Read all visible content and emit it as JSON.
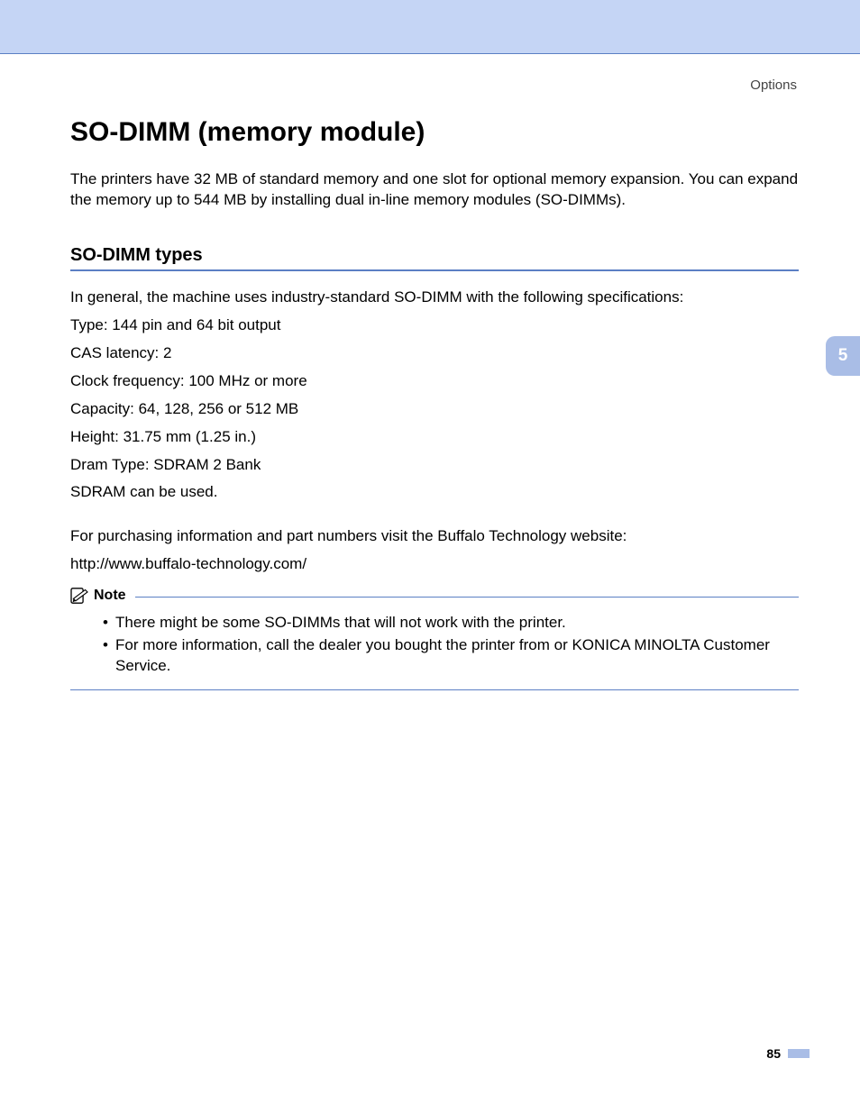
{
  "header": {
    "section_label": "Options"
  },
  "title": "SO-DIMM (memory module)",
  "intro": "The printers have 32 MB of standard memory and one slot for optional memory expansion. You can expand the memory up to 544 MB by installing dual in-line memory modules (SO-DIMMs).",
  "subheading": "SO-DIMM types",
  "specs": {
    "lead": "In general, the machine uses industry-standard SO-DIMM with the following specifications:",
    "lines": [
      "Type: 144 pin and 64 bit output",
      "CAS latency: 2",
      "Clock frequency: 100 MHz or more",
      "Capacity: 64, 128, 256 or 512 MB",
      "Height: 31.75 mm (1.25 in.)",
      "Dram Type: SDRAM 2 Bank",
      "SDRAM can be used."
    ],
    "purchase_line": "For purchasing information and part numbers visit the Buffalo Technology website:",
    "url": "http://www.buffalo-technology.com/"
  },
  "note": {
    "title": "Note",
    "items": [
      "There might be some SO-DIMMs that will not work with the printer.",
      "For more information, call the dealer you bought the printer from or KONICA MINOLTA Customer Service."
    ]
  },
  "side_tab": "5",
  "page_number": "85"
}
